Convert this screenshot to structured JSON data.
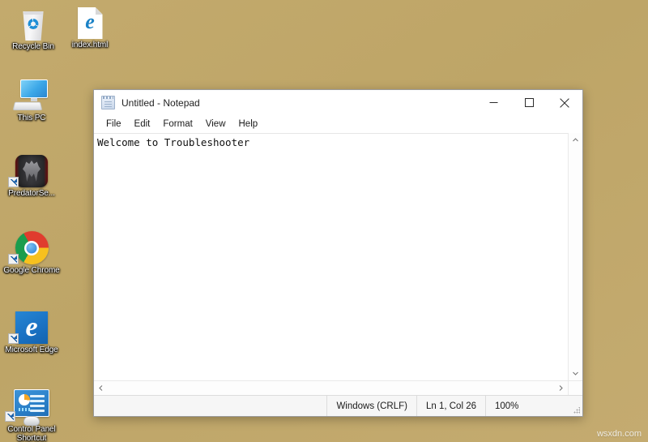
{
  "desktop": {
    "background_color": "#c0a96e",
    "watermark": "wsxdn.com",
    "icons": [
      {
        "label": "Recycle Bin",
        "icon": "recycle-bin-icon",
        "shortcut": false
      },
      {
        "label": "index.html",
        "icon": "html-document-edge-icon",
        "shortcut": false
      },
      {
        "label": "This PC",
        "icon": "computer-monitor-icon",
        "shortcut": false
      },
      {
        "label": "PredatorSe...",
        "icon": "predator-sense-icon",
        "shortcut": true
      },
      {
        "label": "Google Chrome",
        "icon": "google-chrome-icon",
        "shortcut": true
      },
      {
        "label": "Microsoft Edge",
        "icon": "microsoft-edge-icon",
        "shortcut": true
      },
      {
        "label": "Control Panel Shortcut",
        "icon": "control-panel-icon",
        "shortcut": true
      }
    ]
  },
  "notepad": {
    "title": "Untitled - Notepad",
    "app_icon": "notepad-icon",
    "window_controls": {
      "minimize": "minimize-icon",
      "maximize": "maximize-icon",
      "close": "close-icon"
    },
    "menu": [
      {
        "label": "File"
      },
      {
        "label": "Edit"
      },
      {
        "label": "Format"
      },
      {
        "label": "View"
      },
      {
        "label": "Help"
      }
    ],
    "editor": {
      "text": "Welcome to Troubleshooter"
    },
    "scrollbars": {
      "vertical_up": "chevron-up-icon",
      "vertical_down": "chevron-down-icon",
      "horizontal_left": "chevron-left-icon",
      "horizontal_right": "chevron-right-icon"
    },
    "statusbar": {
      "line_ending": "Windows (CRLF)",
      "cursor_position": "Ln 1, Col 26",
      "zoom": "100%"
    }
  }
}
